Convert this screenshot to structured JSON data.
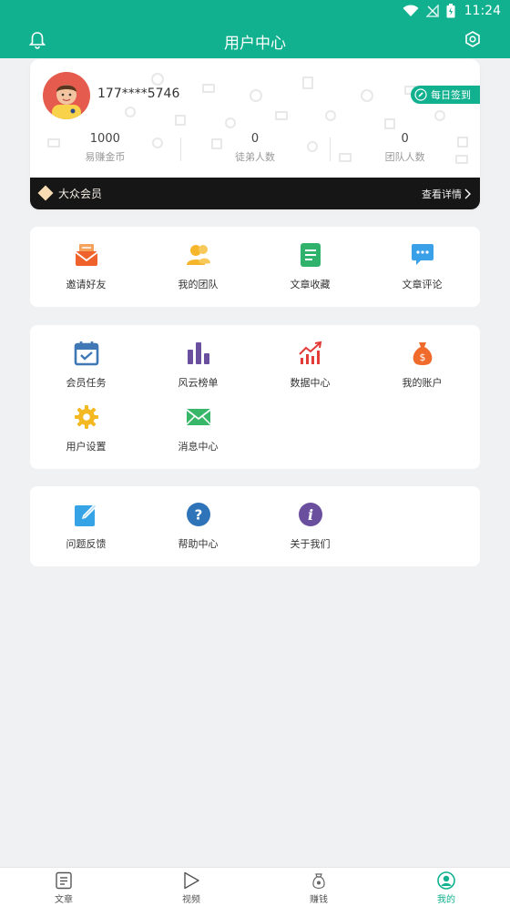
{
  "status_bar": {
    "time": "11:24"
  },
  "header": {
    "title": "用户中心"
  },
  "profile": {
    "phone": "177****5746",
    "checkin_label": "每日签到",
    "stats": [
      {
        "value": "1000",
        "label": "易赚金币"
      },
      {
        "value": "0",
        "label": "徒弟人数"
      },
      {
        "value": "0",
        "label": "团队人数"
      }
    ],
    "membership": {
      "level": "大众会员",
      "detail_label": "查看详情"
    }
  },
  "sections": {
    "first": [
      {
        "label": "邀请好友",
        "icon": "invite-envelope-icon",
        "color": "#f0622c"
      },
      {
        "label": "我的团队",
        "icon": "team-icon",
        "color": "#f6b62b"
      },
      {
        "label": "文章收藏",
        "icon": "article-collect-icon",
        "color": "#2fb26c"
      },
      {
        "label": "文章评论",
        "icon": "comment-icon",
        "color": "#3aa0e8"
      }
    ],
    "second": [
      {
        "label": "会员任务",
        "icon": "calendar-check-icon",
        "color": "#3f78b5"
      },
      {
        "label": "风云榜单",
        "icon": "bar-chart-icon",
        "color": "#6a4f9e"
      },
      {
        "label": "数据中心",
        "icon": "trend-chart-icon",
        "color": "#e23b38"
      },
      {
        "label": "我的账户",
        "icon": "money-bag-icon",
        "color": "#f06b2b"
      },
      {
        "label": "用户设置",
        "icon": "gear-icon",
        "color": "#f4b921"
      },
      {
        "label": "消息中心",
        "icon": "mail-icon",
        "color": "#38b768"
      }
    ],
    "third": [
      {
        "label": "问题反馈",
        "icon": "edit-feedback-icon",
        "color": "#35a3e6"
      },
      {
        "label": "帮助中心",
        "icon": "question-icon",
        "color": "#2f73b8"
      },
      {
        "label": "关于我们",
        "icon": "info-icon",
        "color": "#6a4f9e"
      }
    ]
  },
  "tabbar": [
    {
      "label": "文章",
      "icon": "article-icon",
      "active": false
    },
    {
      "label": "视频",
      "icon": "play-icon",
      "active": false
    },
    {
      "label": "赚钱",
      "icon": "money-icon",
      "active": false
    },
    {
      "label": "我的",
      "icon": "user-icon",
      "active": true
    }
  ],
  "colors": {
    "brand": "#11b18f",
    "member_bar": "#161616",
    "background": "#f0f1f3"
  }
}
